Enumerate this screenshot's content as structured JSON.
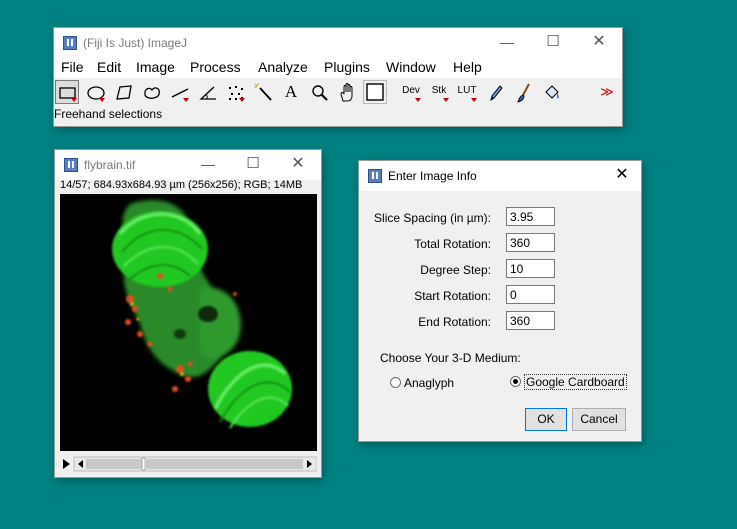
{
  "imagej": {
    "title": "(Fiji Is Just) ImageJ",
    "menus": [
      "File",
      "Edit",
      "Image",
      "Process",
      "Analyze",
      "Plugins",
      "Window",
      "Help"
    ],
    "tools": [
      {
        "name": "rectangle-tool-icon"
      },
      {
        "name": "oval-tool-icon"
      },
      {
        "name": "polygon-tool-icon"
      },
      {
        "name": "freehand-tool-icon"
      },
      {
        "name": "line-tool-icon"
      },
      {
        "name": "angle-tool-icon"
      },
      {
        "name": "multipoint-tool-icon"
      },
      {
        "name": "wand-tool-icon"
      },
      {
        "name": "text-tool-icon",
        "label": "A"
      },
      {
        "name": "magnifier-tool-icon"
      },
      {
        "name": "hand-tool-icon"
      },
      {
        "name": "color-picker-tool-icon"
      },
      {
        "name": "dev-menu",
        "label": "Dev"
      },
      {
        "name": "stk-menu",
        "label": "Stk"
      },
      {
        "name": "lut-menu",
        "label": "LUT"
      },
      {
        "name": "pencil-tool-icon"
      },
      {
        "name": "paintbrush-tool-icon"
      },
      {
        "name": "flood-fill-tool-icon"
      },
      {
        "name": "more-tools-icon",
        "label": "≫"
      }
    ],
    "status": "Freehand selections"
  },
  "flybrain": {
    "title": "flybrain.tif",
    "info": "14/57; 684.93x684.93 µm (256x256); RGB; 14MB"
  },
  "dialog": {
    "title": "Enter Image Info",
    "fields": [
      {
        "label": "Slice Spacing (in µm):",
        "value": "3.95"
      },
      {
        "label": "Total Rotation:",
        "value": "360"
      },
      {
        "label": "Degree Step:",
        "value": "10"
      },
      {
        "label": "Start Rotation:",
        "value": "0"
      },
      {
        "label": "End Rotation:",
        "value": "360"
      }
    ],
    "medium_label": "Choose Your 3-D Medium:",
    "options": [
      {
        "label": "Anaglyph",
        "checked": false
      },
      {
        "label": "Google Cardboard",
        "checked": true
      }
    ],
    "ok_label": "OK",
    "cancel_label": "Cancel"
  },
  "colors": {
    "desktop": "#008080",
    "green_channel": "#22e022",
    "red_channel": "#e05020"
  }
}
